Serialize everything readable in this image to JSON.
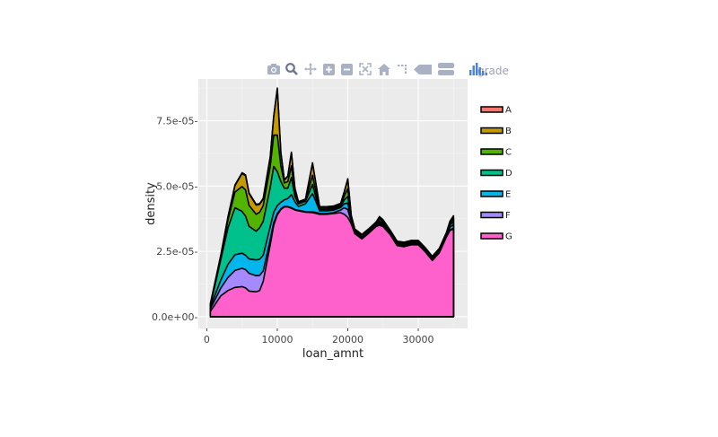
{
  "chart_data": {
    "type": "area",
    "stacked": true,
    "xlabel": "loan_amnt",
    "ylabel": "density",
    "xlim": [
      -1200,
      37000
    ],
    "ylim": [
      -4.5e-06,
      9.1e-05
    ],
    "x_ticks": [
      0,
      10000,
      20000,
      30000
    ],
    "y_ticks": [
      0,
      2.5e-05,
      5e-05,
      7.5e-05
    ],
    "x_tick_labels": [
      "0",
      "10000",
      "20000",
      "30000"
    ],
    "y_tick_labels": [
      "0.0e+00-",
      "2.5e-05-",
      "5.0e-05-",
      "7.5e-05-"
    ],
    "legend_title": "grade",
    "legend_position": "right",
    "grid": true,
    "x": [
      500,
      2000,
      3000,
      4000,
      5000,
      5500,
      6000,
      7000,
      7500,
      8000,
      9000,
      9500,
      10000,
      10500,
      11000,
      11500,
      12000,
      12500,
      13000,
      14000,
      15000,
      15500,
      16000,
      17000,
      18000,
      19000,
      19500,
      20000,
      20500,
      21000,
      22000,
      23000,
      24000,
      24500,
      25000,
      26000,
      27000,
      28000,
      29000,
      30000,
      31000,
      32000,
      33000,
      34000,
      34500,
      35000
    ],
    "series": [
      {
        "name": "G",
        "color": "#FF61CC",
        "values": [
          2e-06,
          8e-06,
          1e-05,
          1.12e-05,
          1.15e-05,
          1.1e-05,
          9.8e-06,
          9.5e-06,
          1e-05,
          1.35e-05,
          2.75e-05,
          3.5e-05,
          3.9e-05,
          4.1e-05,
          4.2e-05,
          4.2e-05,
          4.15e-05,
          4.08e-05,
          4.05e-05,
          4e-05,
          3.98e-05,
          3.95e-05,
          3.92e-05,
          3.92e-05,
          3.95e-05,
          3.98e-05,
          3.92e-05,
          3.8e-05,
          3.55e-05,
          3.18e-05,
          2.98e-05,
          3.2e-05,
          3.45e-05,
          3.5e-05,
          3.45e-05,
          3.15e-05,
          2.72e-05,
          2.68e-05,
          2.75e-05,
          2.75e-05,
          2.48e-05,
          2.15e-05,
          2.45e-05,
          3.05e-05,
          3.3e-05,
          3.35e-05
        ]
      },
      {
        "name": "F",
        "color": "#A58AFF",
        "values": [
          1e-06,
          3e-06,
          5e-06,
          6.5e-06,
          7e-06,
          7e-06,
          6.8e-06,
          6.2e-06,
          5.8e-06,
          4e-06,
          2e-06,
          1e-06,
          5e-07,
          3e-07,
          2e-07,
          2e-07,
          2e-07,
          2e-07,
          2e-07,
          2e-07,
          3e-07,
          4e-07,
          3e-07,
          3e-07,
          3e-07,
          1e-06,
          2.5e-06,
          3e-06,
          8e-07,
          3e-07,
          3e-07,
          3e-07,
          3e-07,
          5e-07,
          5e-07,
          3e-07,
          3e-07,
          3e-07,
          3e-07,
          3e-07,
          2e-07,
          2e-07,
          3e-07,
          3e-07,
          3e-07,
          3e-07
        ]
      },
      {
        "name": "E",
        "color": "#00B6EB",
        "values": [
          8e-07,
          3e-06,
          5e-06,
          6e-06,
          5.8e-06,
          5.5e-06,
          5.5e-06,
          6e-06,
          6.2e-06,
          6e-06,
          5e-06,
          4e-06,
          3e-06,
          2.5e-06,
          2.5e-06,
          3e-06,
          5e-06,
          3e-06,
          1.5e-06,
          3e-06,
          7e-06,
          4e-06,
          1e-06,
          1e-06,
          1e-06,
          1e-06,
          1.5e-06,
          2.5e-06,
          8e-07,
          5e-07,
          4e-07,
          4e-07,
          4e-07,
          5e-07,
          5e-07,
          4e-07,
          4e-07,
          4e-07,
          4e-07,
          4e-07,
          4e-07,
          4e-07,
          4e-07,
          4e-07,
          1e-06,
          1.5e-06
        ]
      },
      {
        "name": "D",
        "color": "#00C08B",
        "values": [
          5e-07,
          8e-06,
          1.4e-05,
          1.8e-05,
          1.6e-05,
          1.5e-05,
          1.25e-05,
          1.1e-05,
          1.2e-05,
          1.3e-05,
          1.5e-05,
          1.75e-05,
          1.3e-05,
          8e-06,
          4.5e-06,
          4e-06,
          6.5e-06,
          2e-06,
          1e-06,
          1e-06,
          3.5e-06,
          1.5e-06,
          5e-07,
          5e-07,
          5e-07,
          5e-07,
          1.5e-06,
          2.5e-06,
          5e-07,
          4e-07,
          4e-07,
          4e-07,
          4e-07,
          5e-07,
          5e-07,
          4e-07,
          4e-07,
          4e-07,
          4e-07,
          4e-07,
          4e-07,
          4e-07,
          4e-07,
          4e-07,
          8e-07,
          1.2e-06
        ]
      },
      {
        "name": "C",
        "color": "#53B400",
        "values": [
          3e-07,
          1e-06,
          3e-06,
          6e-06,
          9.5e-06,
          1e-05,
          8e-06,
          6.5e-06,
          6e-06,
          6e-06,
          8e-06,
          1.2e-05,
          1.4e-05,
          6e-06,
          2e-06,
          2.5e-06,
          4.5e-06,
          1.5e-06,
          5e-07,
          5e-07,
          3.5e-06,
          2e-06,
          5e-07,
          5e-07,
          5e-07,
          5e-07,
          1.5e-06,
          3e-06,
          5e-07,
          3e-07,
          3e-07,
          3e-07,
          3e-07,
          8e-07,
          5e-07,
          3e-07,
          3e-07,
          3e-07,
          3e-07,
          3e-07,
          3e-07,
          3e-07,
          3e-07,
          3e-07,
          8e-07,
          1e-06
        ]
      },
      {
        "name": "B",
        "color": "#C49A00",
        "values": [
          2e-07,
          5e-07,
          1e-06,
          2.5e-06,
          5e-06,
          5.5e-06,
          4.5e-06,
          3.5e-06,
          3e-06,
          2.5e-06,
          3.5e-06,
          7e-06,
          1.75e-05,
          5e-06,
          1e-06,
          2e-06,
          5e-06,
          1.5e-06,
          2e-07,
          2e-07,
          4.5e-06,
          3e-06,
          5e-07,
          5e-07,
          5e-07,
          5e-07,
          1.5e-06,
          3.5e-06,
          5e-07,
          2e-07,
          2e-07,
          2e-07,
          2e-07,
          5e-07,
          3e-07,
          2e-07,
          2e-07,
          2e-07,
          2e-07,
          2e-07,
          2e-07,
          2e-07,
          2e-07,
          2e-07,
          5e-07,
          8e-07
        ]
      },
      {
        "name": "A",
        "color": "#F8766D",
        "values": [
          1e-07,
          2e-07,
          2e-07,
          2e-07,
          3e-07,
          3e-07,
          3e-07,
          3e-07,
          3e-07,
          3e-07,
          3e-07,
          3e-07,
          5e-07,
          3e-07,
          2e-07,
          2e-07,
          3e-07,
          2e-07,
          1e-07,
          1e-07,
          3e-07,
          2e-07,
          1e-07,
          1e-07,
          1e-07,
          1e-07,
          2e-07,
          3e-07,
          1e-07,
          1e-07,
          1e-07,
          1e-07,
          1e-07,
          5e-07,
          3e-07,
          1e-07,
          1e-07,
          1e-07,
          1e-07,
          1e-07,
          1e-07,
          1e-07,
          1e-07,
          1e-07,
          2e-07,
          3e-07
        ]
      }
    ],
    "legend_order": [
      "A",
      "B",
      "C",
      "D",
      "E",
      "F",
      "G"
    ]
  },
  "modebar": {
    "icons": [
      "camera-icon",
      "zoom-icon",
      "pan-icon",
      "zoom-in-icon",
      "zoom-out-icon",
      "autoscale-icon",
      "reset-axes-icon",
      "spike-lines-icon",
      "hover-closest-icon",
      "hover-compare-icon",
      "plotly-logo-icon"
    ]
  }
}
